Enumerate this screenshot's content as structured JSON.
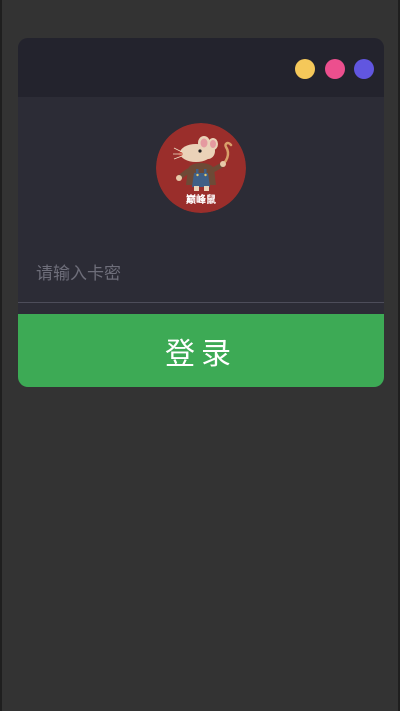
{
  "window_controls": {
    "colors": [
      "#f5c85a",
      "#ec4f8e",
      "#6156e0"
    ]
  },
  "logo": {
    "icon": "rat-mascot-logo",
    "caption": "巅峰鼠",
    "background_color": "#9a2e2b"
  },
  "login_form": {
    "card_key_placeholder": "请输入卡密",
    "card_key_value": "",
    "submit_label": "登录"
  },
  "colors": {
    "page_background": "#333333",
    "card_background": "#2c2c36",
    "titlebar_background": "#23232d",
    "button_background": "#3daa55"
  }
}
